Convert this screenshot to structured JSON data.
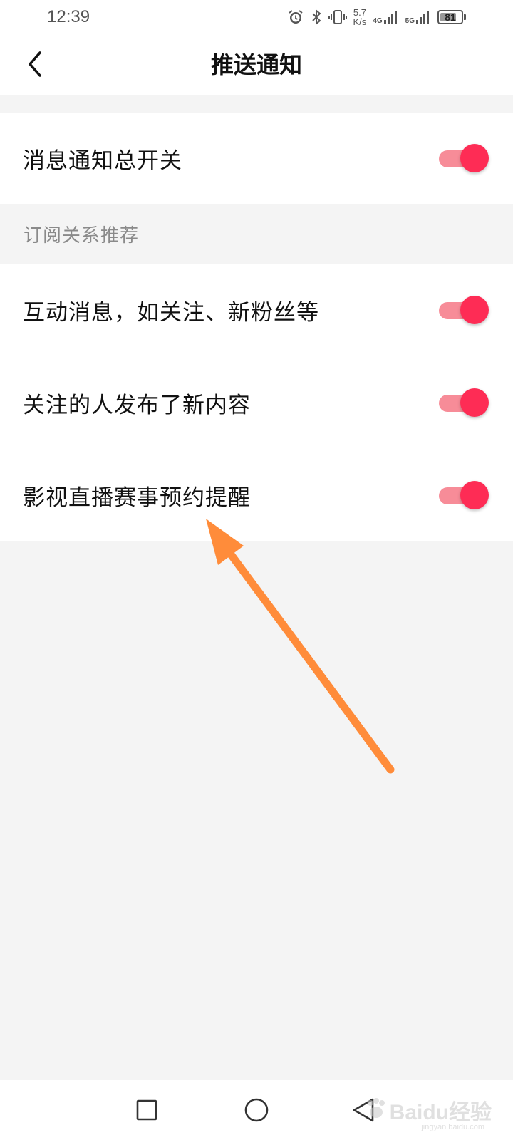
{
  "status_bar": {
    "time": "12:39",
    "net_speed_value": "5.7",
    "net_speed_unit": "K/s",
    "sim1_type": "4G",
    "sim2_type": "5G",
    "battery_level": 81,
    "battery_text": "81",
    "icons": [
      "alarm-icon",
      "bluetooth-icon",
      "vibrate-icon",
      "signal-icon",
      "battery-icon"
    ]
  },
  "header": {
    "title": "推送通知",
    "back_icon": "chevron-left-icon"
  },
  "master": {
    "label": "消息通知总开关",
    "enabled": true
  },
  "subscription_section": {
    "title": "订阅关系推荐",
    "items": [
      {
        "label": "互动消息，如关注、新粉丝等",
        "enabled": true
      },
      {
        "label": "关注的人发布了新内容",
        "enabled": true
      },
      {
        "label": "影视直播赛事预约提醒",
        "enabled": true
      }
    ]
  },
  "nav_bar": {
    "icons": [
      "recent-apps-icon",
      "home-icon",
      "back-triangle-icon"
    ],
    "watermark_text": "Baidu经验",
    "watermark_sub": "jingyan.baidu.com"
  },
  "colors": {
    "toggle_on_thumb": "#fe2c55",
    "toggle_on_track": "#f78c98",
    "annotation_arrow": "#ff8c3a",
    "page_bg": "#f4f4f4"
  }
}
